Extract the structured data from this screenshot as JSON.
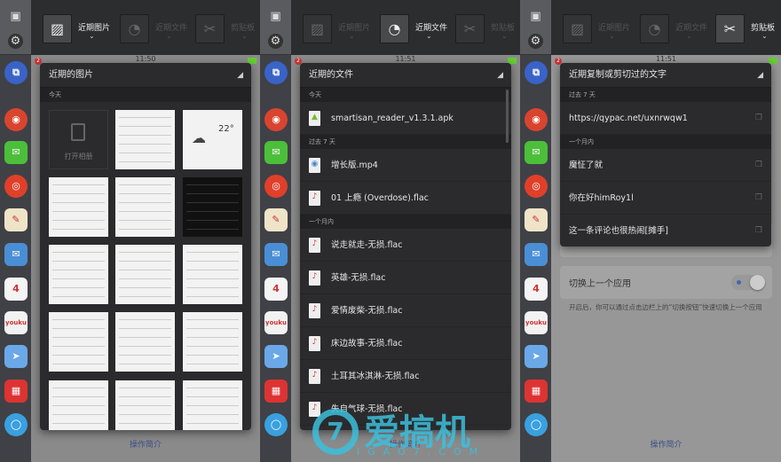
{
  "tabs": [
    "近期图片",
    "近期文件",
    "剪贴板"
  ],
  "tab_icons": [
    "image-icon",
    "pie-chart-icon",
    "scissors-icon"
  ],
  "sidebar_apps": [
    {
      "name": "switch-app-icon",
      "color": "#3a63c8",
      "glyph": "⧉"
    },
    {
      "name": "chrome-icon",
      "color": "#d9442f",
      "glyph": "◉"
    },
    {
      "name": "wechat-icon",
      "color": "#4cbf3a",
      "glyph": "✉"
    },
    {
      "name": "weibo-icon",
      "color": "#e0402a",
      "glyph": "◎"
    },
    {
      "name": "notes-icon",
      "color": "#efe4c8",
      "glyph": "✎"
    },
    {
      "name": "mail-icon",
      "color": "#4a8ed6",
      "glyph": "✉"
    },
    {
      "name": "calendar-icon",
      "color": "#f4f4f4",
      "glyph": "4"
    },
    {
      "name": "youku-icon",
      "color": "#f2f2f2",
      "glyph": "youku"
    },
    {
      "name": "paper-plane-icon",
      "color": "#6aa8e8",
      "glyph": "➤"
    },
    {
      "name": "gift-calendar-icon",
      "color": "#d33",
      "glyph": "▦"
    },
    {
      "name": "circle-app-icon",
      "color": "#3aa0e0",
      "glyph": "◯"
    }
  ],
  "panels": [
    {
      "active_tab": 0,
      "time": "11:50",
      "popup_title": "近期的图片",
      "section": "今天",
      "open_album": "打开相册",
      "weather_temp": "22°",
      "footer": "操作简介"
    },
    {
      "active_tab": 1,
      "time": "11:51",
      "popup_title": "近期的文件",
      "groups": [
        {
          "label": "今天",
          "items": [
            {
              "name": "smartisan_reader_v1.3.1.apk",
              "type": "apk"
            }
          ]
        },
        {
          "label": "过去 7 天",
          "items": [
            {
              "name": "增长版.mp4",
              "type": "video"
            },
            {
              "name": "01 上瘾 (Overdose).flac",
              "type": "audio"
            }
          ]
        },
        {
          "label": "一个月内",
          "items": [
            {
              "name": "说走就走-无损.flac",
              "type": "audio"
            },
            {
              "name": "英雄-无损.flac",
              "type": "audio"
            },
            {
              "name": "爱情废柴-无损.flac",
              "type": "audio"
            },
            {
              "name": "床边故事-无损.flac",
              "type": "audio"
            },
            {
              "name": "土耳其冰淇淋-无损.flac",
              "type": "audio"
            },
            {
              "name": "失自气球-无损.flac",
              "type": "audio"
            }
          ]
        }
      ],
      "footer": "操作简介"
    },
    {
      "active_tab": 2,
      "time": "11:51",
      "popup_title": "近期复制或剪切过的文字",
      "groups": [
        {
          "label": "过去 7 天",
          "items": [
            {
              "name": "https://qypac.net/uxnrwqw1"
            }
          ]
        },
        {
          "label": "一个月内",
          "items": [
            {
              "name": "魔怔了就"
            },
            {
              "name": "你在好himRoy1l"
            },
            {
              "name": "这一条评论也很热闹[摊手]"
            }
          ]
        }
      ],
      "setting_title": "切换上一个应用",
      "setting_desc": "开启后，你可以通过点击边栏上的“切换按钮”快速切换上一个应用",
      "toggle_on": false,
      "footer": "操作简介"
    }
  ],
  "watermark": {
    "text": "爱搞机",
    "sub": "IGAO7.COM",
    "mark": "7"
  }
}
